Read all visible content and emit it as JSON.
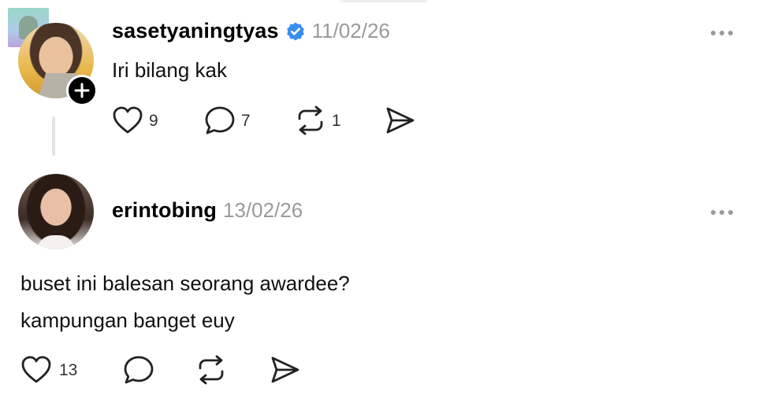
{
  "posts": [
    {
      "username": "sasetyaningtyas",
      "verified": true,
      "date": "11/02/26",
      "text": "Iri bilang kak",
      "likes": "9",
      "replies": "7",
      "reposts": "1"
    },
    {
      "username": "erintobing",
      "verified": false,
      "date": "13/02/26",
      "text_lines": [
        "buset ini balesan seorang awardee?",
        "kampungan banget euy"
      ],
      "likes": "13"
    }
  ],
  "icons": {
    "verified_color": "#3a8df0",
    "like": "heart-icon",
    "reply": "comment-bubble-icon",
    "repost": "repost-icon",
    "share": "send-icon",
    "more": "more-options-icon",
    "follow": "plus-icon"
  }
}
